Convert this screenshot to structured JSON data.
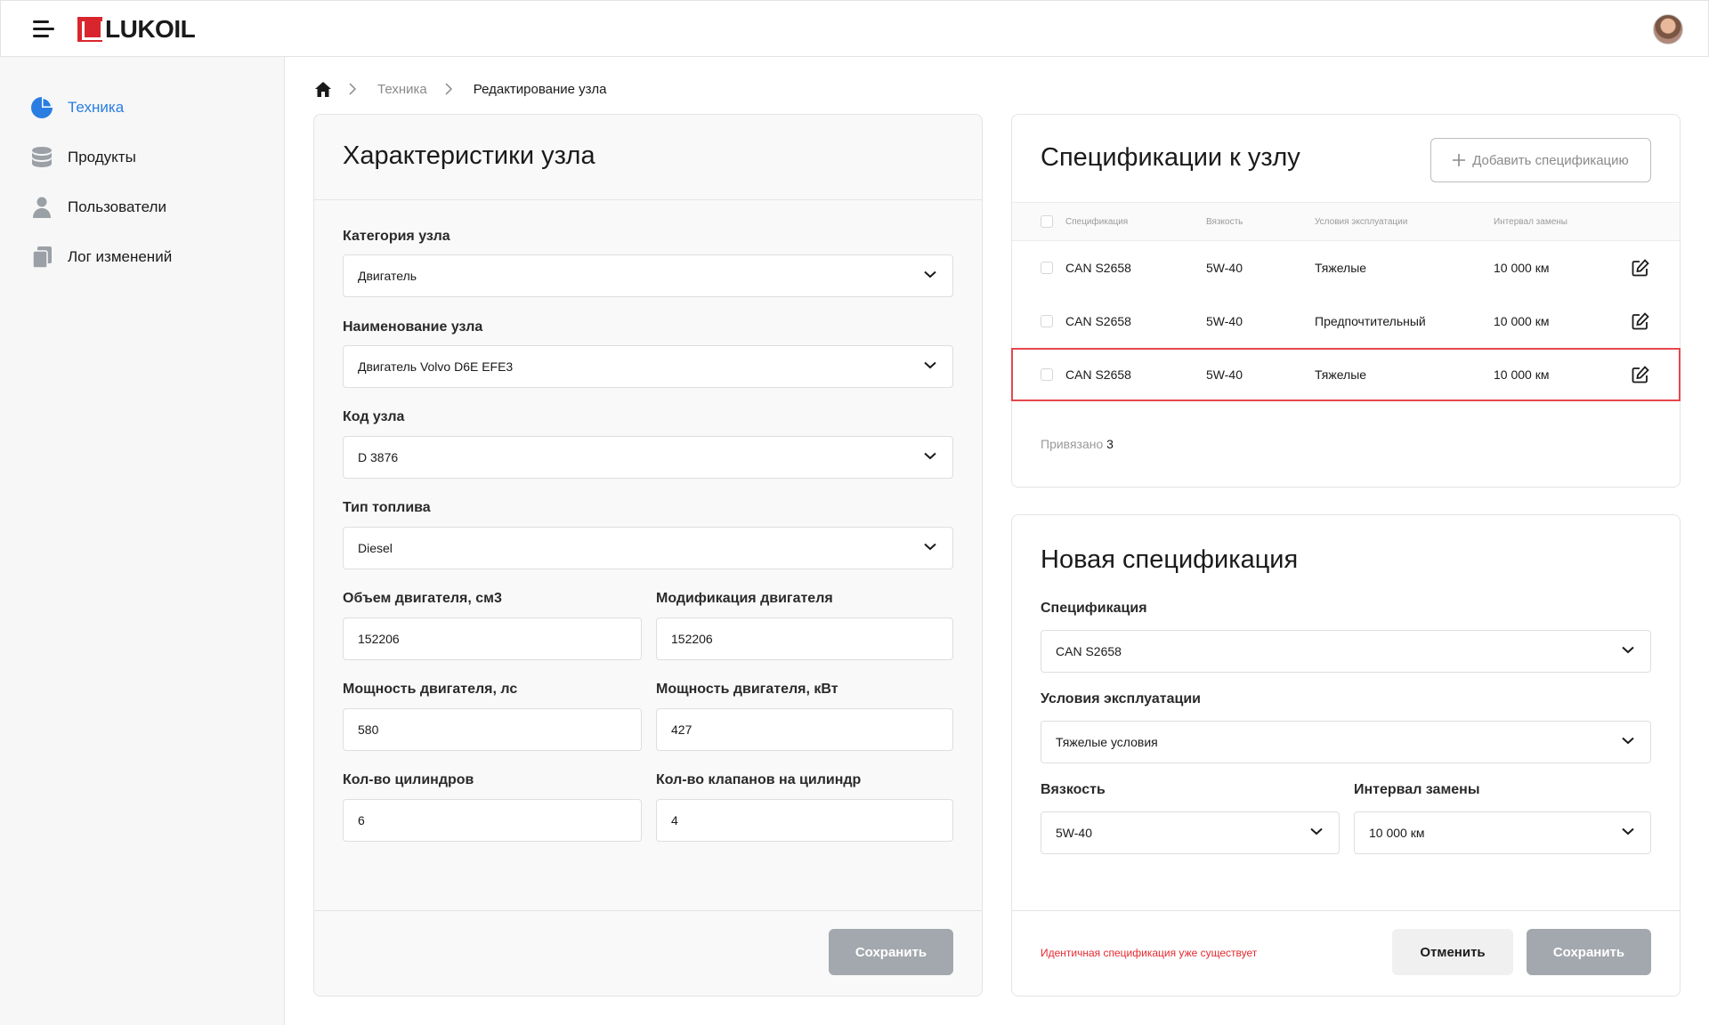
{
  "header": {
    "menu_icon": "hamburger-icon",
    "logo_text": "LUKOIL",
    "avatar_icon": "user-avatar"
  },
  "sidebar": {
    "items": [
      {
        "label": "Техника",
        "icon": "pie-chart-icon",
        "active": true
      },
      {
        "label": "Продукты",
        "icon": "database-icon",
        "active": false
      },
      {
        "label": "Пользователи",
        "icon": "user-icon",
        "active": false
      },
      {
        "label": "Лог изменений",
        "icon": "documents-icon",
        "active": false
      }
    ]
  },
  "breadcrumb": {
    "home_icon": "home-icon",
    "items": [
      "Техника",
      "Редактирование узла"
    ]
  },
  "node_card": {
    "title": "Характеристики узла",
    "fields": {
      "category": {
        "label": "Категория узла",
        "value": "Двигатель"
      },
      "name": {
        "label": "Наименование узла",
        "value": "Двигатель Volvo D6E EFE3"
      },
      "code": {
        "label": "Код узла",
        "value": "D 3876"
      },
      "fuel": {
        "label": "Тип топлива",
        "value": "Diesel"
      },
      "volume": {
        "label": "Объем двигателя, см3",
        "value": "152206"
      },
      "modification": {
        "label": "Модификация двигателя",
        "value": "152206"
      },
      "power_hp": {
        "label": "Мощность двигателя, лс",
        "value": "580"
      },
      "power_kw": {
        "label": "Мощность двигателя, кВт",
        "value": "427"
      },
      "cylinders": {
        "label": "Кол-во цилиндров",
        "value": "6"
      },
      "valves": {
        "label": "Кол-во клапанов на цилиндр",
        "value": "4"
      }
    },
    "save_label": "Сохранить"
  },
  "specs_card": {
    "title": "Спецификации к узлу",
    "add_label": "Добавить спецификацию",
    "columns": [
      "Спецификация",
      "Вязкость",
      "Условия эксплуатации",
      "Интервал замены"
    ],
    "rows": [
      {
        "spec": "CAN S2658",
        "viscosity": "5W-40",
        "conditions": "Тяжелые",
        "interval": "10 000 км"
      },
      {
        "spec": "CAN S2658",
        "viscosity": "5W-40",
        "conditions": "Предпочтительный",
        "interval": "10 000 км"
      },
      {
        "spec": "CAN S2658",
        "viscosity": "5W-40",
        "conditions": "Тяжелые",
        "interval": "10 000 км"
      }
    ],
    "bound_label": "Привязано",
    "bound_count": "3",
    "highlight_color": "#e5484d"
  },
  "new_spec_card": {
    "title": "Новая спецификация",
    "fields": {
      "spec": {
        "label": "Спецификация",
        "value": "CAN S2658"
      },
      "conditions": {
        "label": "Условия эксплуатации",
        "value": "Тяжелые условия"
      },
      "viscosity": {
        "label": "Вязкость",
        "value": "5W-40"
      },
      "interval": {
        "label": "Интервал замены",
        "value": "10 000 км"
      }
    },
    "error": "Идентичная спецификация уже существует",
    "cancel_label": "Отменить",
    "save_label": "Сохранить"
  },
  "colors": {
    "accent": "#2a7de1",
    "brand": "#d9262e",
    "error": "#e5292f",
    "disabled_button": "#a3a8ae"
  }
}
